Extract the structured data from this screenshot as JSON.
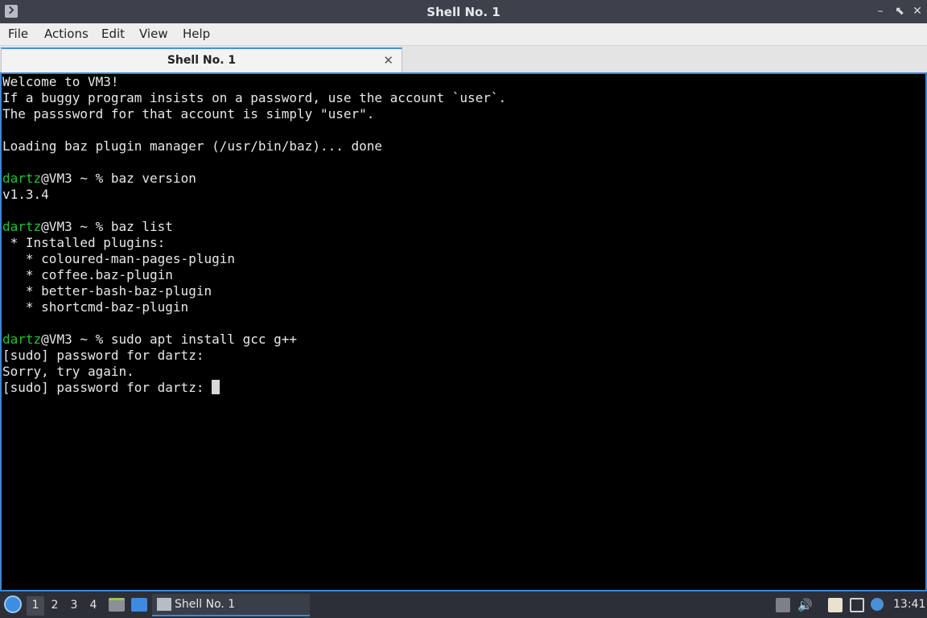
{
  "window": {
    "title": "Shell No. 1",
    "buttons": [
      "–",
      "⬉",
      "✕"
    ]
  },
  "menu": [
    "File",
    "Actions",
    "Edit",
    "View",
    "Help"
  ],
  "tab": {
    "label": "Shell No. 1",
    "close": "✕"
  },
  "terminal": {
    "lines": [
      {
        "text": "Welcome to VM3!"
      },
      {
        "text": "If a buggy program insists on a password, use the account `user`."
      },
      {
        "text": "The passsword for that account is simply \"user\"."
      },
      {
        "text": ""
      },
      {
        "text": "Loading baz plugin manager (/usr/bin/baz)... done"
      },
      {
        "text": ""
      },
      {
        "user": "dartz",
        "text": "@VM3 ~ % baz version"
      },
      {
        "text": "v1.3.4"
      },
      {
        "text": ""
      },
      {
        "user": "dartz",
        "text": "@VM3 ~ % baz list"
      },
      {
        "text": " * Installed plugins:"
      },
      {
        "text": "   * coloured-man-pages-plugin"
      },
      {
        "text": "   * coffee.baz-plugin"
      },
      {
        "text": "   * better-bash-baz-plugin"
      },
      {
        "text": "   * shortcmd-baz-plugin"
      },
      {
        "text": ""
      },
      {
        "user": "dartz",
        "text": "@VM3 ~ % sudo apt install gcc g++"
      },
      {
        "text": "[sudo] password for dartz:"
      },
      {
        "text": "Sorry, try again."
      },
      {
        "text": "[sudo] password for dartz: ",
        "cursor": true
      }
    ],
    "colors": {
      "background": "#000000",
      "foreground": "#e8e8e8",
      "prompt_user": "#21c23a",
      "border": "#3f86d6"
    }
  },
  "taskbar": {
    "workspaces": [
      "1",
      "2",
      "3",
      "4"
    ],
    "active_workspace": "1",
    "task_label": "Shell No. 1",
    "clock": "13:41"
  }
}
